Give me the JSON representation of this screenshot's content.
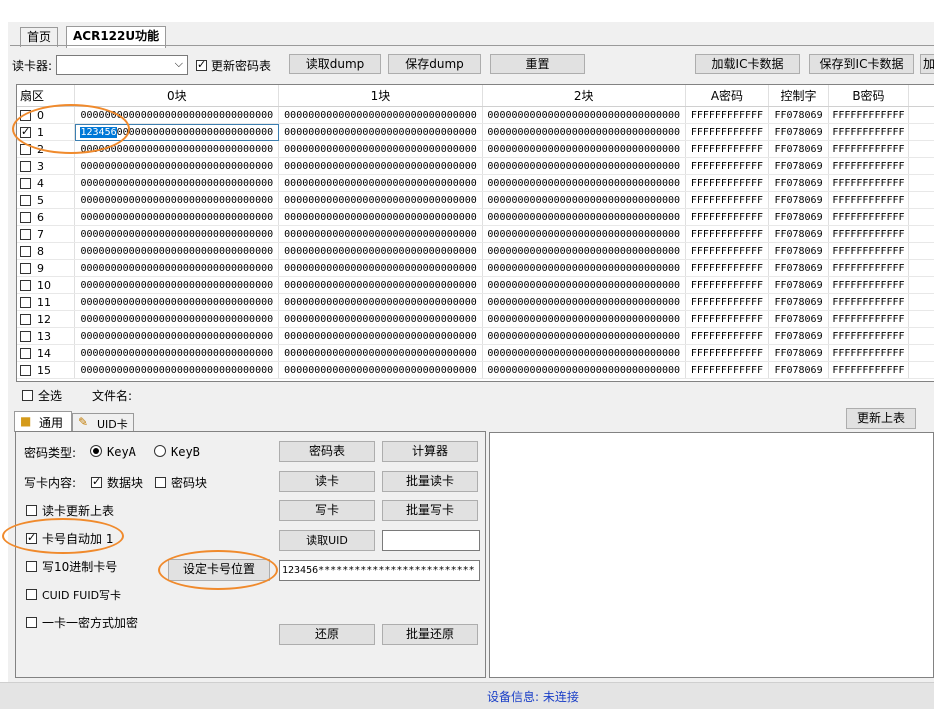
{
  "tabs": [
    {
      "label": "首页"
    },
    {
      "label": "ACR122U功能"
    }
  ],
  "toolbar": {
    "reader_label": "读卡器:",
    "reader_value": "",
    "update_pwd_table_label": "更新密码表",
    "update_pwd_table_checked": true,
    "read_dump": "读取dump",
    "save_dump": "保存dump",
    "reset": "重置",
    "load_ic": "加载IC卡数据",
    "save_ic": "保存到IC卡数据",
    "cut_btn": "加"
  },
  "grid": {
    "headers": [
      "扇区",
      "0块",
      "1块",
      "2块",
      "A密码",
      "控制字",
      "B密码"
    ],
    "zero": "00000000000000000000000000000000",
    "edit_prefix": "123456",
    "edit_rest": "00000000000000000000000000",
    "keyA": "FFFFFFFFFFFF",
    "ctrl": "FF078069",
    "keyB": "FFFFFFFFFFFF",
    "sectors": [
      "0",
      "1",
      "2",
      "3",
      "4",
      "5",
      "6",
      "7",
      "8",
      "9",
      "10",
      "11",
      "12",
      "13",
      "14",
      "15"
    ]
  },
  "below_grid": {
    "select_all": "全选",
    "file_name": "文件名:",
    "refresh_table": "更新上表"
  },
  "subtabs": [
    {
      "label": "通用"
    },
    {
      "label": "UID卡"
    }
  ],
  "general": {
    "pwd_type_label": "密码类型:",
    "keyA": "KeyA",
    "keyB": "KeyB",
    "write_content_label": "写卡内容:",
    "data_block": "数据块",
    "pwd_block": "密码块",
    "read_update": "读卡更新上表",
    "auto_increment": "卡号自动加 1",
    "write_decimal": "写10进制卡号",
    "cuid_fuid": "CUID FUID写卡",
    "one_card_one_pwd": "一卡一密方式加密",
    "pwd_table_btn": "密码表",
    "calculator_btn": "计算器",
    "read_btn": "读卡",
    "batch_read_btn": "批量读卡",
    "write_btn": "写卡",
    "batch_write_btn": "批量写卡",
    "read_uid_btn": "读取UID",
    "uid_value": "",
    "set_card_pos_btn": "设定卡号位置",
    "card_pattern": "123456**************************",
    "restore_btn": "还原",
    "batch_restore_btn": "批量还原"
  },
  "status": {
    "text": "设备信息: 未连接"
  }
}
